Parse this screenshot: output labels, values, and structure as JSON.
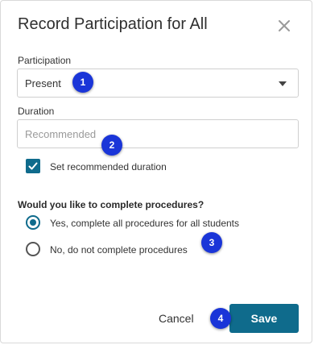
{
  "dialog": {
    "title": "Record Participation for All",
    "close_icon": "close-x-icon"
  },
  "participation": {
    "label": "Participation",
    "selected": "Present"
  },
  "duration": {
    "label": "Duration",
    "placeholder": "Recommended",
    "value": ""
  },
  "recommended_checkbox": {
    "label": "Set recommended duration",
    "checked": true
  },
  "procedures": {
    "question": "Would you like to complete procedures?",
    "options": [
      {
        "label": "Yes, complete all procedures for all students",
        "selected": true
      },
      {
        "label": "No, do not complete procedures",
        "selected": false
      }
    ]
  },
  "footer": {
    "cancel_label": "Cancel",
    "save_label": "Save"
  },
  "callouts": [
    "1",
    "2",
    "3",
    "4"
  ],
  "colors": {
    "primary": "#0f6b8c",
    "callout": "#1a35d8"
  }
}
